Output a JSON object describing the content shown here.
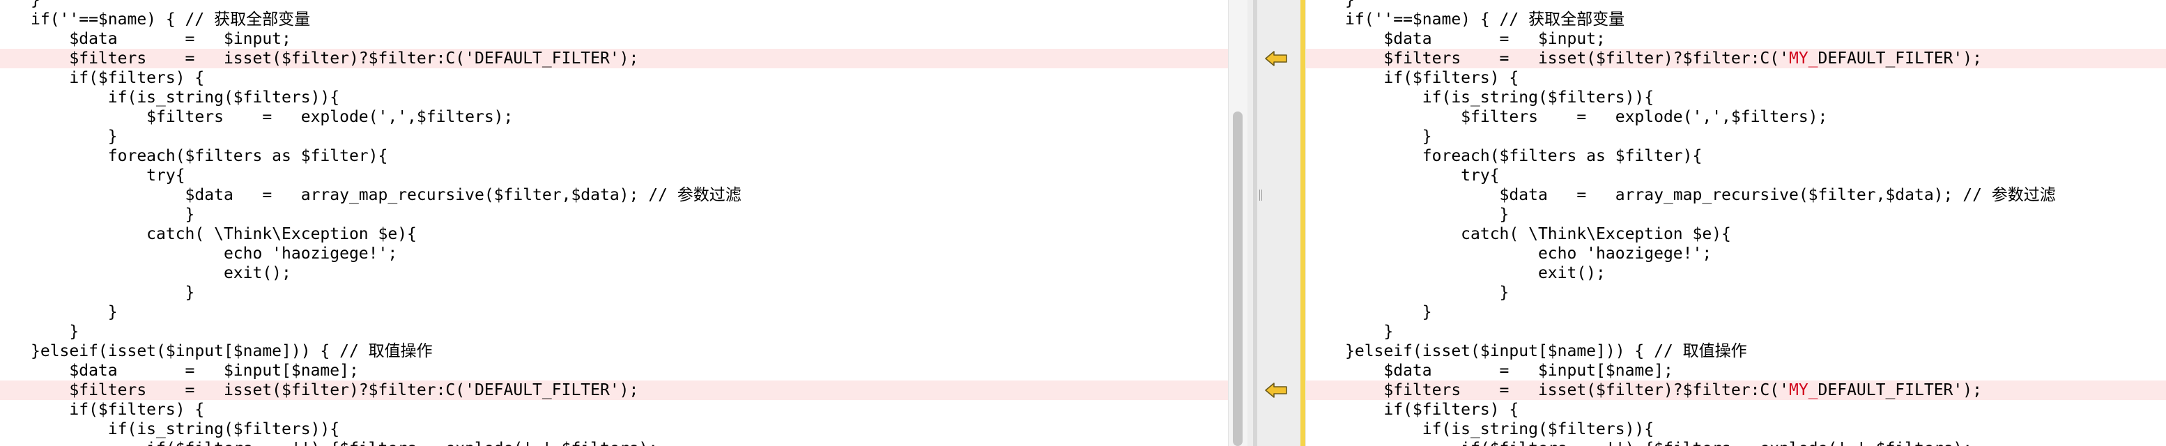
{
  "left_pane": {
    "lines": [
      {
        "text": "}",
        "changed": false
      },
      {
        "text": "if(''==$name) { // 获取全部变量",
        "changed": false
      },
      {
        "text": "    $data       =   $input;",
        "changed": false
      },
      {
        "text": "    $filters    =   isset($filter)?$filter:C('DEFAULT_FILTER');",
        "changed": true
      },
      {
        "text": "    if($filters) {",
        "changed": false
      },
      {
        "text": "        if(is_string($filters)){",
        "changed": false
      },
      {
        "text": "            $filters    =   explode(',',$filters);",
        "changed": false
      },
      {
        "text": "        }",
        "changed": false
      },
      {
        "text": "        foreach($filters as $filter){",
        "changed": false
      },
      {
        "text": "            try{",
        "changed": false
      },
      {
        "text": "                $data   =   array_map_recursive($filter,$data); // 参数过滤",
        "changed": false
      },
      {
        "text": "                }",
        "changed": false
      },
      {
        "text": "            catch( \\Think\\Exception $e){",
        "changed": false
      },
      {
        "text": "                    echo 'haozigege!';",
        "changed": false
      },
      {
        "text": "                    exit();",
        "changed": false
      },
      {
        "text": "                }",
        "changed": false
      },
      {
        "text": "        }",
        "changed": false
      },
      {
        "text": "    }",
        "changed": false
      },
      {
        "text": "}elseif(isset($input[$name])) { // 取值操作",
        "changed": false
      },
      {
        "text": "    $data       =   $input[$name];",
        "changed": false
      },
      {
        "text": "    $filters    =   isset($filter)?$filter:C('DEFAULT_FILTER');",
        "changed": true
      },
      {
        "text": "    if($filters) {",
        "changed": false
      },
      {
        "text": "        if(is_string($filters)){",
        "changed": false
      },
      {
        "text": "            if($filters == '') {$filters = explode(',',$filters);",
        "changed": false
      }
    ]
  },
  "right_pane": {
    "lines": [
      {
        "text": "}",
        "changed": false
      },
      {
        "text": "if(''==$name) { // 获取全部变量",
        "changed": false
      },
      {
        "text": "    $data       =   $input;",
        "changed": false
      },
      {
        "pre": "    $filters    =   isset($filter)?$filter:C('",
        "hl": "MY_",
        "post": "DEFAULT_FILTER');",
        "changed": true
      },
      {
        "text": "    if($filters) {",
        "changed": false
      },
      {
        "text": "        if(is_string($filters)){",
        "changed": false
      },
      {
        "text": "            $filters    =   explode(',',$filters);",
        "changed": false
      },
      {
        "text": "        }",
        "changed": false
      },
      {
        "text": "        foreach($filters as $filter){",
        "changed": false
      },
      {
        "text": "            try{",
        "changed": false
      },
      {
        "text": "                $data   =   array_map_recursive($filter,$data); // 参数过滤",
        "changed": false
      },
      {
        "text": "                }",
        "changed": false
      },
      {
        "text": "            catch( \\Think\\Exception $e){",
        "changed": false
      },
      {
        "text": "                    echo 'haozigege!';",
        "changed": false
      },
      {
        "text": "                    exit();",
        "changed": false
      },
      {
        "text": "                }",
        "changed": false
      },
      {
        "text": "        }",
        "changed": false
      },
      {
        "text": "    }",
        "changed": false
      },
      {
        "text": "}elseif(isset($input[$name])) { // 取值操作",
        "changed": false
      },
      {
        "text": "    $data       =   $input[$name];",
        "changed": false
      },
      {
        "pre": "    $filters    =   isset($filter)?$filter:C('",
        "hl": "MY_",
        "post": "DEFAULT_FILTER');",
        "changed": true
      },
      {
        "text": "    if($filters) {",
        "changed": false
      },
      {
        "text": "        if(is_string($filters)){",
        "changed": false
      },
      {
        "text": "            if($filters == '') {$filters = explode(',',$filters);",
        "changed": false
      }
    ]
  },
  "merge_gutter": {
    "arrows": [
      {
        "icon": "arrow-left-icon",
        "line_index": 3
      },
      {
        "icon": "arrow-left-icon",
        "line_index": 20
      }
    ]
  },
  "colors": {
    "changed_line_background": "#fde8e8",
    "highlight_text": "#d0021b",
    "arrow_fill": "#f2c12e",
    "gutter_marker": "#f5d44a"
  }
}
